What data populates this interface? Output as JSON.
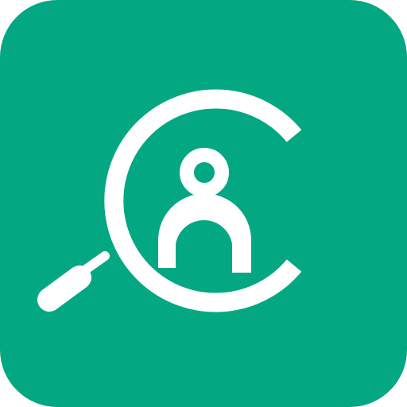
{
  "app_icon": {
    "name": "people-search-app-icon",
    "background_color": "#03A882",
    "foreground_color": "#FFFFFF",
    "symbols": [
      "magnifier-icon",
      "person-icon"
    ]
  }
}
